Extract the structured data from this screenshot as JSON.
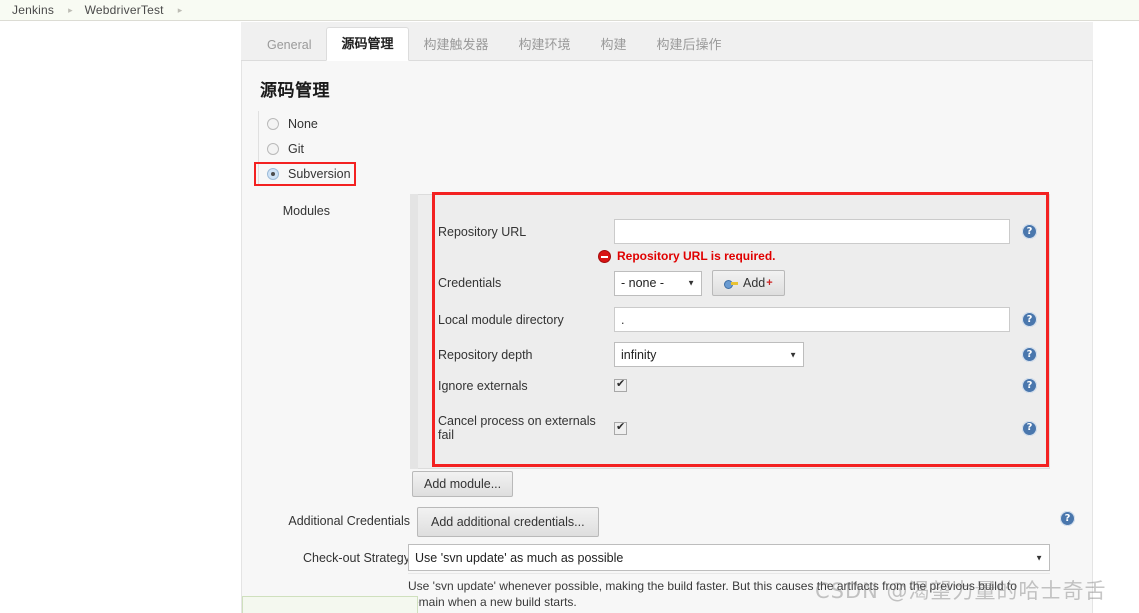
{
  "breadcrumb": {
    "items": [
      {
        "label": "Jenkins"
      },
      {
        "label": "WebdriverTest"
      }
    ],
    "separator": "▸"
  },
  "tabs": [
    {
      "label": "General",
      "active": false
    },
    {
      "label": "源码管理",
      "active": true
    },
    {
      "label": "构建触发器",
      "active": false
    },
    {
      "label": "构建环境",
      "active": false
    },
    {
      "label": "构建",
      "active": false
    },
    {
      "label": "构建后操作",
      "active": false
    }
  ],
  "section": {
    "title": "源码管理"
  },
  "scm_options": [
    {
      "label": "None",
      "selected": false
    },
    {
      "label": "Git",
      "selected": false
    },
    {
      "label": "Subversion",
      "selected": true
    }
  ],
  "modules": {
    "label": "Modules",
    "add_module_button": "Add module...",
    "fields": {
      "repository_url": {
        "label": "Repository URL",
        "value": "",
        "error": "Repository URL is required."
      },
      "credentials": {
        "label": "Credentials",
        "value": "- none -",
        "add_button": "Add"
      },
      "local_module_directory": {
        "label": "Local module directory",
        "value": "."
      },
      "repository_depth": {
        "label": "Repository depth",
        "value": "infinity"
      },
      "ignore_externals": {
        "label": "Ignore externals",
        "checked": true
      },
      "cancel_process_on_externals_fail": {
        "label": "Cancel process on externals fail",
        "checked": true
      }
    }
  },
  "additional_credentials": {
    "label": "Additional Credentials",
    "button": "Add additional credentials..."
  },
  "checkout_strategy": {
    "label": "Check-out Strategy",
    "value": "Use 'svn update' as much as possible",
    "description_line1": "Use 'svn update' whenever possible, making the build faster. But this causes the artifacts from the previous build to",
    "description_line2": "remain when a new build starts."
  },
  "icons": {
    "help": "?",
    "help_name": "help-icon",
    "error_name": "error-icon",
    "key_name": "key-icon",
    "chevron": "▼"
  },
  "watermark": {
    "text": "CSDN @渴望力量的哈士奇舌"
  },
  "colors": {
    "highlight_red": "#f32121",
    "error_red": "#e00000",
    "help_blue": "#4a77ad",
    "panel_bg": "#f7f7f7",
    "module_bg": "#ededed"
  }
}
